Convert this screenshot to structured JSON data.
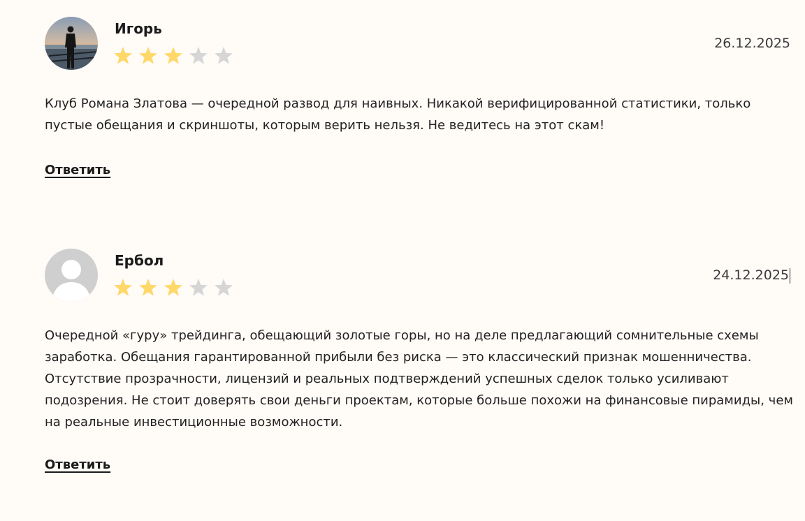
{
  "reviews": [
    {
      "author": "Игорь",
      "date": "26.12.2025",
      "rating": 3,
      "max_rating": 5,
      "avatar": "photo-avatar",
      "text": "Клуб Романа Златова — очередной развод для наивных. Никакой верифицированной статистики, только пустые обещания и скриншоты, которым верить нельзя. Не ведитесь на этот скам!",
      "reply_label": "Ответить"
    },
    {
      "author": "Ербол",
      "date": "24.12.2025",
      "rating": 3,
      "max_rating": 5,
      "avatar": "default-user-avatar",
      "text": "Очередной «гуру» трейдинга, обещающий золотые горы, но на деле предлагающий сомнительные схемы заработка. Обещания гарантированной прибыли без риска — это классический признак мошенничества. Отсутствие прозрачности, лицензий и реальных подтверждений успешных сделок только усиливают подозрения. Не стоит доверять свои деньги проектам, которые больше похожи на финансовые пирамиды, чем на реальные инвестиционные возможности.",
      "reply_label": "Ответить"
    }
  ],
  "colors": {
    "background": "#fffbf7",
    "star_filled": "#ffd86a",
    "star_empty": "#d6d6d6",
    "text": "#222222"
  }
}
